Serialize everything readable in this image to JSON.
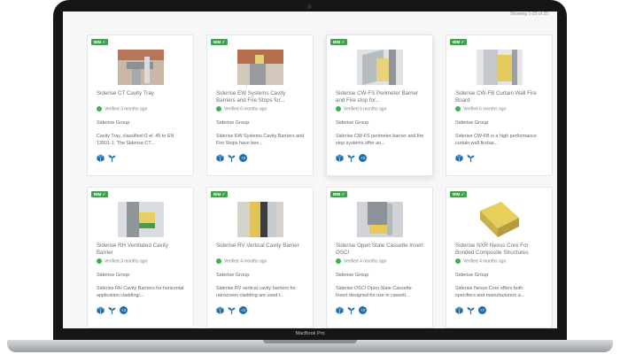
{
  "device": {
    "brand": "MacBook Pro"
  },
  "results": {
    "showing": "Showing 1-25 of 25"
  },
  "cards": [
    {
      "badge": "BIM ✓",
      "title": "Siderise CT Cavity Tray",
      "verified": "Verified 3 months ago",
      "manufacturer": "Siderise Group",
      "description": "Cavity Tray, classified t2 el. 45 to EN 13501-1. The Siderise CT...",
      "count": ""
    },
    {
      "badge": "BIM ✓",
      "title": "Siderise EW Systems Cavity Barriers and Fire Stops for...",
      "verified": "Verified 6 months ago",
      "manufacturer": "Siderise Group",
      "description": "Siderise EW Systems Cavity Barriers and Fire Stops have bee...",
      "count": "+3"
    },
    {
      "badge": "BIM ✓",
      "title": "Siderise CW-FS Perimeter Barrier and Fire stop for...",
      "verified": "Verified 6 months ago",
      "manufacturer": "Siderise Group",
      "description": "Siderise CW-FS perimeter barrier and fire stop systems offer an...",
      "count": "+3"
    },
    {
      "badge": "BIM ✓",
      "title": "Siderise CW-FB Curtain Wall Fire Board",
      "verified": "Verified 6 months ago",
      "manufacturer": "Siderise Group",
      "description": "Siderise CW-FB is a high performance curtain wall firebar...",
      "count": ""
    },
    {
      "badge": "BIM ✓",
      "title": "Siderise RH Ventilated Cavity Barrier",
      "verified": "Verified 3 months ago",
      "manufacturer": "Siderise Group",
      "description": "Siderise RH Cavity Barriers for horizontal application cladding/...",
      "count": "+3"
    },
    {
      "badge": "BIM ✓",
      "title": "Siderise RV Vertical Cavity Barrier",
      "verified": "Verified 4 months ago",
      "manufacturer": "Siderise Group",
      "description": "Siderise RV vertical cavity barriers for rainscreen cladding are used t...",
      "count": "+3"
    },
    {
      "badge": "BIM ✓",
      "title": "Siderise Open State Cassette Insert OSCI",
      "verified": "Verified 4 months ago",
      "manufacturer": "Siderise Group",
      "description": "Siderise OSCI Open State Cassette Insert designed for use in cassett...",
      "count": "+3"
    },
    {
      "badge": "BIM ✓",
      "title": "Siderise NXR Nexus Core For Bonded Composite Structures",
      "verified": "Verified 4 months ago",
      "manufacturer": "Siderise Group",
      "description": "Siderise Nexus Core offers both specifiers and manufacturers a...",
      "count": "+7"
    }
  ],
  "icon_names": [
    "bim-cube-icon",
    "sustainability-sprout-icon"
  ],
  "colors": {
    "badge": "#3fa34d",
    "verified_dot": "#3bb24a",
    "icon_blue": "#1e6fa8"
  }
}
